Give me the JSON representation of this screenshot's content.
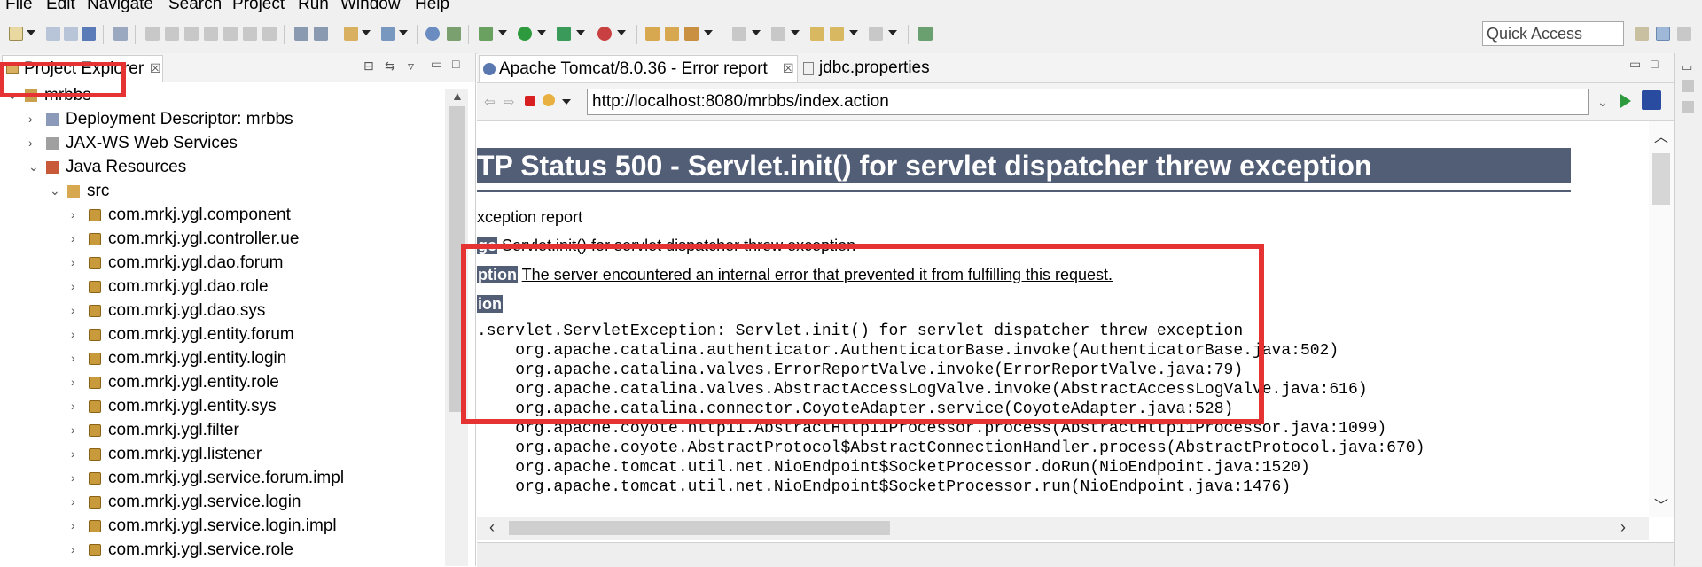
{
  "menu": [
    "File",
    "Edit",
    "Navigate",
    "Search",
    "Project",
    "Run",
    "Window",
    "Help"
  ],
  "toolbar": {
    "quick_access": "Quick Access"
  },
  "project_explorer": {
    "tab_label": "Project Explorer",
    "close_glyph": "☒",
    "tree": [
      {
        "label": "mrbbs",
        "level": 0,
        "arrow": "⌄",
        "icon": "project-icon"
      },
      {
        "label": "Deployment Descriptor: mrbbs",
        "level": 1,
        "arrow": "›",
        "icon": "descriptor-icon"
      },
      {
        "label": "JAX-WS Web Services",
        "level": 1,
        "arrow": "›",
        "icon": "webservice-icon"
      },
      {
        "label": "Java Resources",
        "level": 1,
        "arrow": "⌄",
        "icon": "java-resources-icon"
      },
      {
        "label": "src",
        "level": 2,
        "arrow": "⌄",
        "icon": "source-folder-icon"
      },
      {
        "label": "com.mrkj.ygl.component",
        "level": 3,
        "arrow": "›",
        "icon": "package-icon"
      },
      {
        "label": "com.mrkj.ygl.controller.ue",
        "level": 3,
        "arrow": "›",
        "icon": "package-icon"
      },
      {
        "label": "com.mrkj.ygl.dao.forum",
        "level": 3,
        "arrow": "›",
        "icon": "package-icon"
      },
      {
        "label": "com.mrkj.ygl.dao.role",
        "level": 3,
        "arrow": "›",
        "icon": "package-icon"
      },
      {
        "label": "com.mrkj.ygl.dao.sys",
        "level": 3,
        "arrow": "›",
        "icon": "package-icon"
      },
      {
        "label": "com.mrkj.ygl.entity.forum",
        "level": 3,
        "arrow": "›",
        "icon": "package-icon"
      },
      {
        "label": "com.mrkj.ygl.entity.login",
        "level": 3,
        "arrow": "›",
        "icon": "package-icon"
      },
      {
        "label": "com.mrkj.ygl.entity.role",
        "level": 3,
        "arrow": "›",
        "icon": "package-icon"
      },
      {
        "label": "com.mrkj.ygl.entity.sys",
        "level": 3,
        "arrow": "›",
        "icon": "package-icon"
      },
      {
        "label": "com.mrkj.ygl.filter",
        "level": 3,
        "arrow": "›",
        "icon": "package-icon"
      },
      {
        "label": "com.mrkj.ygl.listener",
        "level": 3,
        "arrow": "›",
        "icon": "package-icon"
      },
      {
        "label": "com.mrkj.ygl.service.forum.impl",
        "level": 3,
        "arrow": "›",
        "icon": "package-icon"
      },
      {
        "label": "com.mrkj.ygl.service.login",
        "level": 3,
        "arrow": "›",
        "icon": "package-icon"
      },
      {
        "label": "com.mrkj.ygl.service.login.impl",
        "level": 3,
        "arrow": "›",
        "icon": "package-icon"
      },
      {
        "label": "com.mrkj.ygl.service.role",
        "level": 3,
        "arrow": "›",
        "icon": "package-icon"
      }
    ]
  },
  "editor": {
    "tabs": [
      {
        "label": "Apache Tomcat/8.0.36 - Error report",
        "active": true
      },
      {
        "label": "jdbc.properties",
        "active": false
      }
    ],
    "tab_close_glyph": "☒",
    "url": "http://localhost:8080/mrbbs/index.action"
  },
  "page": {
    "title": "TP Status 500 - Servlet.init() for servlet dispatcher threw exception",
    "type_line": "xception report",
    "message_label": "ge",
    "message_text": "Servlet.init() for servlet dispatcher threw exception",
    "description_label": "ption",
    "description_text": "The server encountered an internal error that prevented it from fulfilling this request.",
    "exception_label": "ion",
    "stack": [
      ".servlet.ServletException: Servlet.init() for servlet dispatcher threw exception",
      "    org.apache.catalina.authenticator.AuthenticatorBase.invoke(AuthenticatorBase.java:502)",
      "    org.apache.catalina.valves.ErrorReportValve.invoke(ErrorReportValve.java:79)",
      "    org.apache.catalina.valves.AbstractAccessLogValve.invoke(AbstractAccessLogValve.java:616)",
      "    org.apache.catalina.connector.CoyoteAdapter.service(CoyoteAdapter.java:528)",
      "    org.apache.coyote.http11.AbstractHttp11Processor.process(AbstractHttp11Processor.java:1099)",
      "    org.apache.coyote.AbstractProtocol$AbstractConnectionHandler.process(AbstractProtocol.java:670)",
      "    org.apache.tomcat.util.net.NioEndpoint$SocketProcessor.doRun(NioEndpoint.java:1520)",
      "    org.apache.tomcat.util.net.NioEndpoint$SocketProcessor.run(NioEndpoint.java:1476)"
    ]
  },
  "colors": {
    "tomcat_header": "#525d76",
    "highlight_box": "#e53333"
  }
}
